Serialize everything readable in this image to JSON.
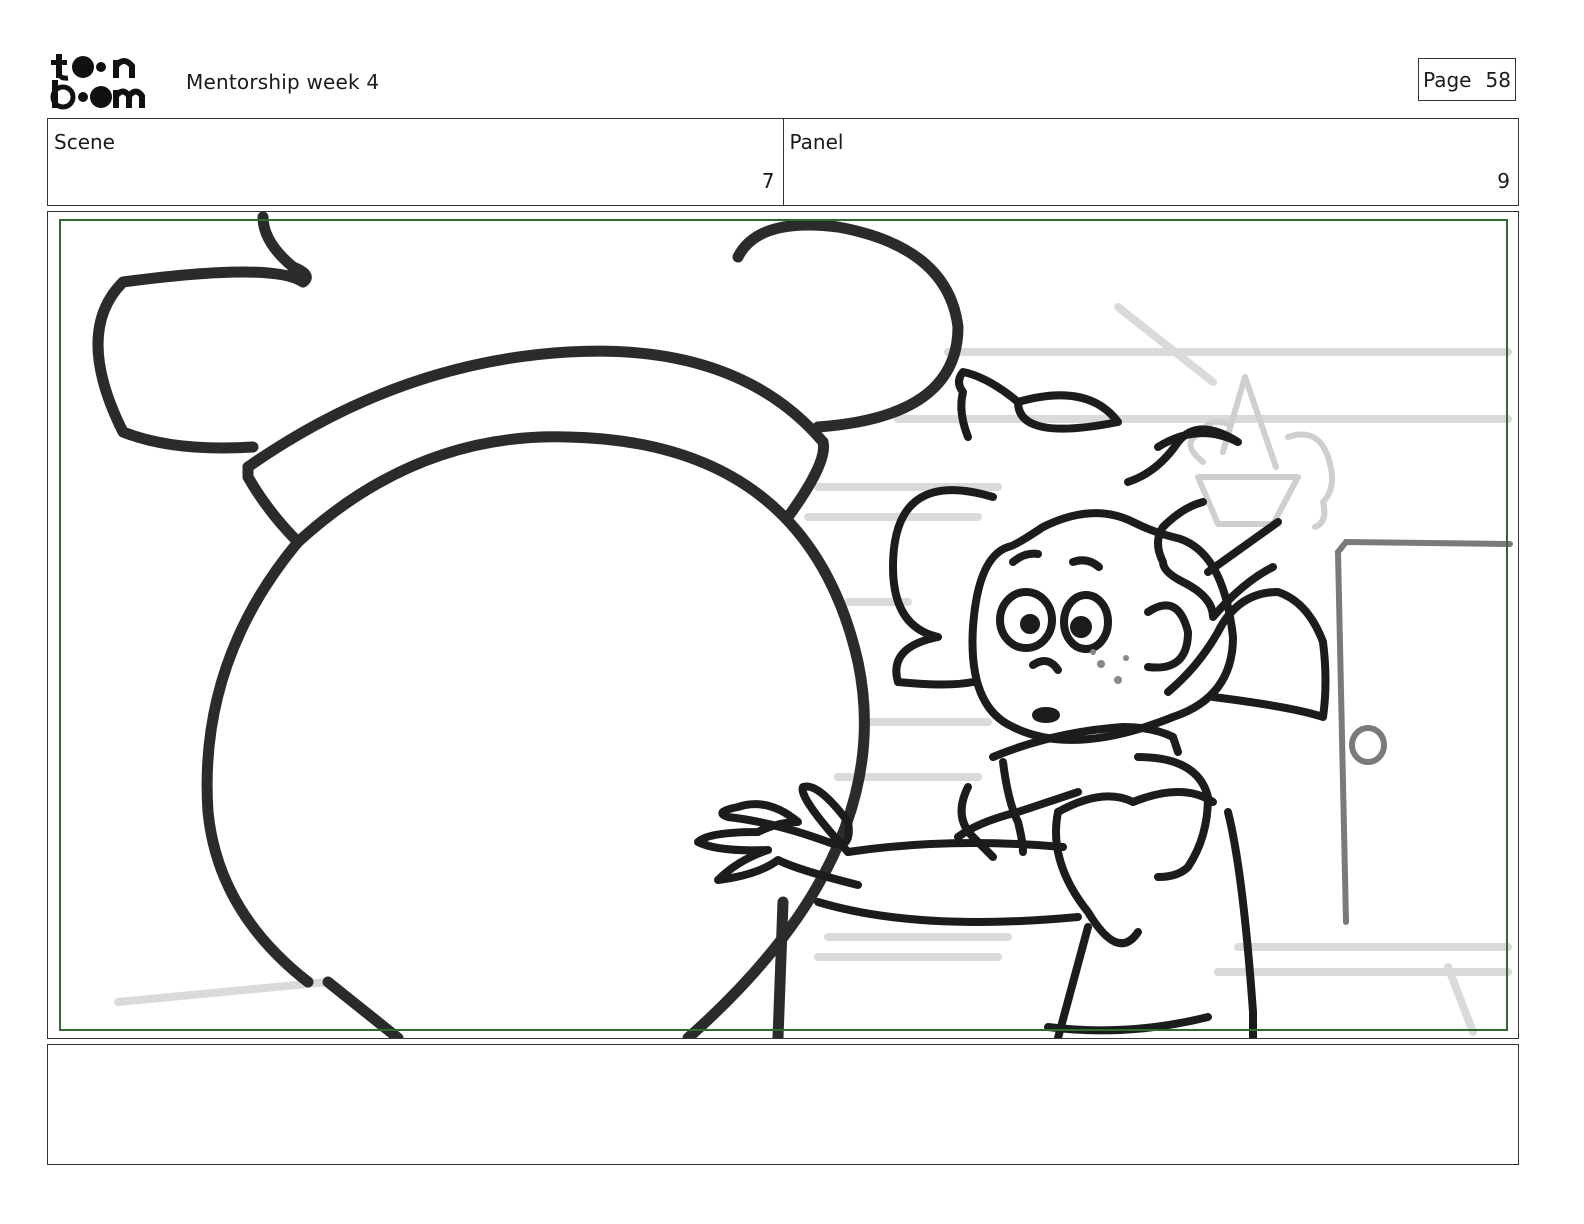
{
  "header": {
    "logo_text": "toon boom",
    "title": "Mentorship week 4",
    "page_label": "Page",
    "page_number": "58"
  },
  "scene": {
    "label": "Scene",
    "value": "7"
  },
  "panel": {
    "label": "Panel",
    "value": "9"
  },
  "notes": {
    "text": ""
  },
  "colors": {
    "ink": "#2b2b2b",
    "safe_area": "#2f6b2f",
    "background_lines": "#d9d9d9",
    "border": "#333333"
  }
}
